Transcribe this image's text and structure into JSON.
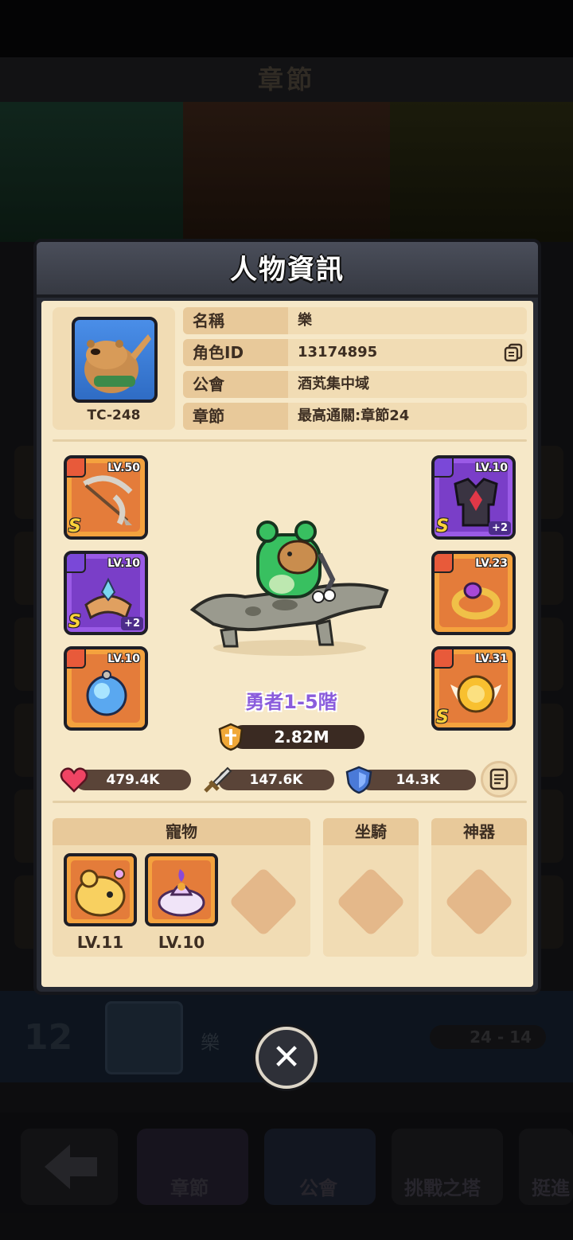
{
  "background": {
    "screen_title": "章節",
    "player_rank": "12",
    "player_name": "樂",
    "player_score": "24 - 14",
    "nav": [
      "章節",
      "公會",
      "挑戰之塔",
      "挺進"
    ]
  },
  "modal": {
    "title": "人物資訊",
    "profile": {
      "code": "TC-248",
      "rows": [
        {
          "label": "名稱",
          "value": "樂"
        },
        {
          "label": "角色ID",
          "value": "13174895"
        },
        {
          "label": "公會",
          "value": "酒芄集中域"
        },
        {
          "label": "章節",
          "value": "最高通關:章節24"
        }
      ]
    },
    "equipment": {
      "left": [
        {
          "level": "LV.50",
          "grade": "S",
          "plus": "",
          "rarity": "orange",
          "icon": "bow-icon"
        },
        {
          "level": "LV.10",
          "grade": "S",
          "plus": "+2",
          "rarity": "purple",
          "icon": "bracer-icon"
        },
        {
          "level": "LV.10",
          "grade": "",
          "plus": "",
          "rarity": "orange",
          "icon": "orb-necklace-icon"
        }
      ],
      "right": [
        {
          "level": "LV.10",
          "grade": "S",
          "plus": "+2",
          "rarity": "purple",
          "icon": "armor-icon"
        },
        {
          "level": "LV.23",
          "grade": "",
          "plus": "",
          "rarity": "orange",
          "icon": "ring-icon"
        },
        {
          "level": "LV.31",
          "grade": "S",
          "plus": "",
          "rarity": "orange",
          "icon": "sun-medal-icon"
        }
      ]
    },
    "hero_rank": "勇者1-5階",
    "power": "2.82M",
    "stats": {
      "hp": "479.4K",
      "attack": "147.6K",
      "defense": "14.3K"
    },
    "sections": {
      "pets_label": "寵物",
      "mount_label": "坐騎",
      "artifact_label": "神器",
      "pets": [
        {
          "level": "LV.11",
          "icon": "yellow-creature-icon"
        },
        {
          "level": "LV.10",
          "icon": "genie-lamp-icon"
        }
      ]
    }
  },
  "colors": {
    "panel": "#f6e8c8",
    "header": "#4a4e5a",
    "accent_purple": "#8a5cdc",
    "orange_rarity": "#f4a23e",
    "purple_rarity": "#9a5ae6"
  }
}
